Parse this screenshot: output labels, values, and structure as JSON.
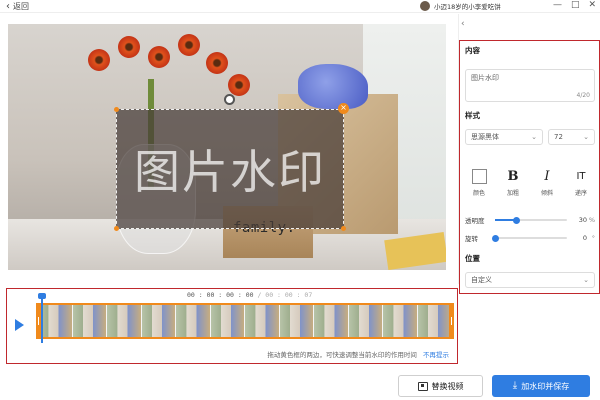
{
  "titlebar": {
    "back_label": "返回",
    "username": "小迈18岁的小李爱吃饼",
    "window_controls": [
      "—",
      "□",
      "✕"
    ]
  },
  "preview": {
    "watermark_text": "图片水印",
    "scene_text": "family."
  },
  "timeline": {
    "current_time": "00 : 00 : 00 : 00",
    "total_time": "/ 00 : 00 : 07",
    "frame_count": 12,
    "playhead_fraction": 0.0,
    "hint": "拖动黄色框的两边，可快速调整当前水印的作用时间",
    "hint_dismiss": "不再提示"
  },
  "panel": {
    "content_title": "内容",
    "content_value": "图片水印",
    "content_counter": "4/20",
    "style_title": "样式",
    "font_value": "思源黑体",
    "size_value": "72",
    "style_buttons": [
      {
        "glyph": "",
        "label": "颜色"
      },
      {
        "glyph": "B",
        "label": "加粗"
      },
      {
        "glyph": "I",
        "label": "倾斜"
      },
      {
        "glyph": "IT",
        "label": "递序"
      }
    ],
    "opacity_label": "透明度",
    "opacity_value": "30",
    "opacity_unit": "%",
    "opacity_fraction": 0.3,
    "rotate_label": "旋转",
    "rotate_value": "0",
    "rotate_unit": "°",
    "rotate_fraction": 0.0,
    "position_title": "位置",
    "position_value": "自定义"
  },
  "actions": {
    "replace_label": "替换视频",
    "save_label": "加水印并保存"
  },
  "colors": {
    "accent": "#2f7de1",
    "orange": "#f08a1c",
    "highlight_red": "#c0282d"
  }
}
